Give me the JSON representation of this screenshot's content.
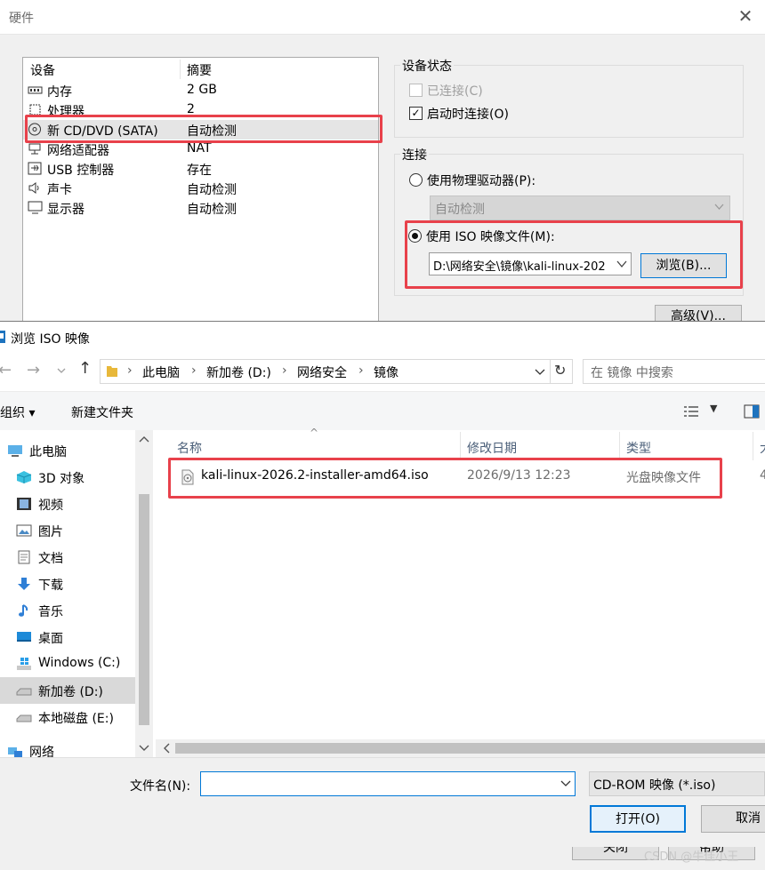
{
  "hardware_dialog": {
    "title": "硬件",
    "close_glyph": "✕",
    "device_list": {
      "col_device": "设备",
      "col_summary": "摘要",
      "rows": [
        {
          "name": "内存",
          "summary": "2 GB"
        },
        {
          "name": "处理器",
          "summary": "2"
        },
        {
          "name": "新 CD/DVD (SATA)",
          "summary": "自动检测"
        },
        {
          "name": "网络适配器",
          "summary": "NAT"
        },
        {
          "name": "USB 控制器",
          "summary": "存在"
        },
        {
          "name": "声卡",
          "summary": "自动检测"
        },
        {
          "name": "显示器",
          "summary": "自动检测"
        }
      ]
    },
    "device_status": {
      "label": "设备状态",
      "connected": "已连接(C)",
      "connect_on_start": "启动时连接(O)",
      "check_glyph": "✓"
    },
    "connection": {
      "label": "连接",
      "physical_drive": "使用物理驱动器(P):",
      "physical_drive_value": "自动检测",
      "use_iso": "使用 ISO 映像文件(M):",
      "iso_path": "D:\\网络安全\\镜像\\kali-linux-202",
      "browse_button": "浏览(B)...",
      "advanced_button": "高级(V)..."
    },
    "close_button": "关闭",
    "help_button": "帮助"
  },
  "browse_dialog": {
    "title": "浏览 ISO 映像",
    "breadcrumb": [
      "此电脑",
      "新加卷 (D:)",
      "网络安全",
      "镜像"
    ],
    "search_placeholder": "在 镜像 中搜索",
    "toolbar": {
      "organize": "组织 ▾",
      "new_folder": "新建文件夹"
    },
    "nav": [
      {
        "label": "此电脑",
        "icon": "computer-icon"
      },
      {
        "label": "3D 对象",
        "icon": "cube-icon"
      },
      {
        "label": "视频",
        "icon": "video-icon"
      },
      {
        "label": "图片",
        "icon": "picture-icon"
      },
      {
        "label": "文档",
        "icon": "document-icon"
      },
      {
        "label": "下载",
        "icon": "download-icon"
      },
      {
        "label": "音乐",
        "icon": "music-icon"
      },
      {
        "label": "桌面",
        "icon": "desktop-icon"
      },
      {
        "label": "Windows (C:)",
        "icon": "windows-drive-icon"
      },
      {
        "label": "新加卷 (D:)",
        "icon": "drive-icon"
      },
      {
        "label": "本地磁盘 (E:)",
        "icon": "drive-icon"
      },
      {
        "label": "网络",
        "icon": "network-icon"
      }
    ],
    "columns": {
      "name": "名称",
      "modified": "修改日期",
      "type": "类型",
      "size": "大"
    },
    "files": [
      {
        "name": "kali-linux-2026.2-installer-amd64.iso",
        "modified": "2026/9/13 12:23",
        "type": "光盘映像文件",
        "size": "4"
      }
    ],
    "filename_label": "文件名(N):",
    "filename_value": "",
    "filetype_value": "CD-ROM 映像 (*.iso)",
    "open_button": "打开(O)",
    "cancel_button": "取消"
  },
  "watermark": "CSDN @牛佳小王",
  "colors": {
    "highlight_red": "#e8414b",
    "accent_blue": "#0078d7"
  }
}
